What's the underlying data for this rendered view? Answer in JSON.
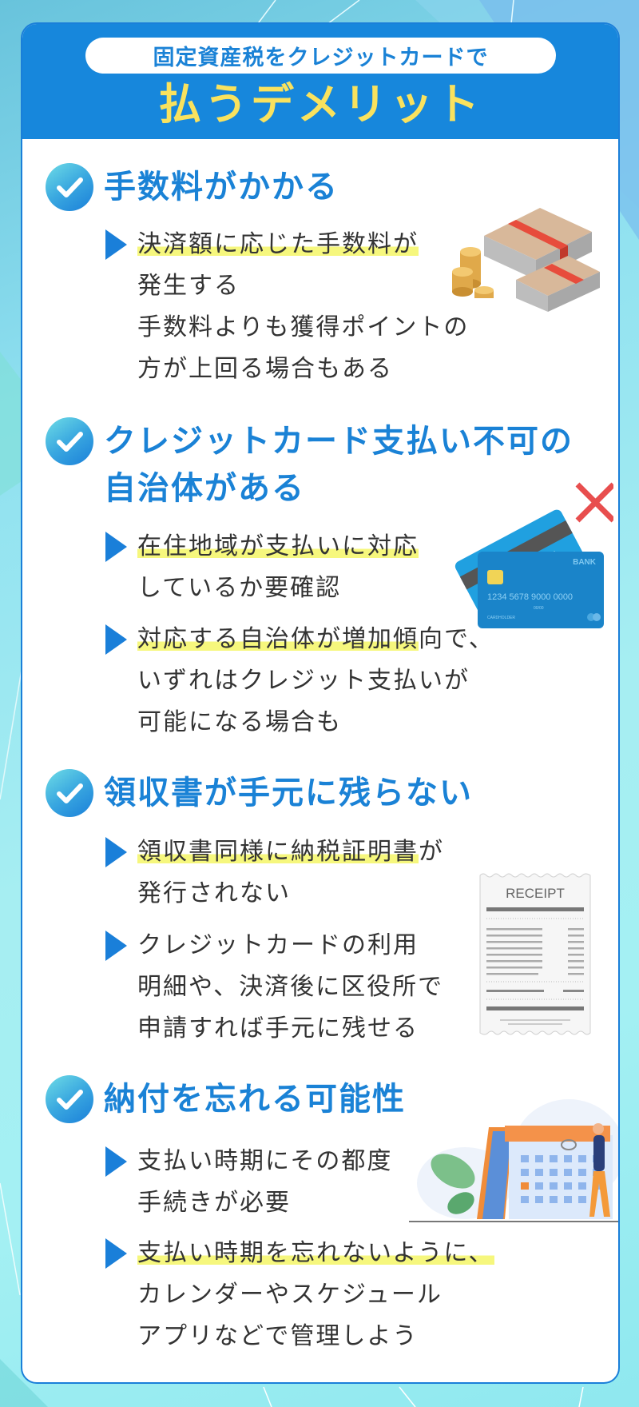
{
  "header": {
    "subtitle": "固定資産税をクレジットカードで",
    "title": "払うデメリット"
  },
  "colors": {
    "accent_blue": "#1a82d6",
    "header_blue": "#1787dc",
    "title_yellow": "#f9e25e",
    "highlight_yellow": "#f6f77d",
    "body_text": "#333333",
    "cross_red": "#e84e4e"
  },
  "sections": [
    {
      "icon": "check-circle-icon",
      "heading_lines": [
        "手数料がかかる"
      ],
      "bullets": [
        {
          "highlight": "決済額に応じた手数料が",
          "rest": "",
          "lines": [
            "発生する",
            "手数料よりも獲得ポイントの",
            "方が上回る場合もある"
          ]
        }
      ],
      "illustration": "money-stacks-and-coins-illustration"
    },
    {
      "icon": "check-circle-icon",
      "heading_lines": [
        "クレジットカード支払い不可の",
        "自治体がある"
      ],
      "bullets": [
        {
          "highlight": "在住地域が支払いに対応",
          "rest": "",
          "lines": [
            "しているか要確認"
          ]
        },
        {
          "highlight": "対応する自治体が増加傾",
          "rest": "向で、",
          "lines": [
            "いずれはクレジット支払いが",
            "可能になる場合も"
          ]
        }
      ],
      "illustration": "credit-cards-with-cross-illustration",
      "card_text": {
        "bank": "BANK",
        "number": "1234 5678 9000 0000",
        "expiry": "00/00",
        "holder": "CARDHOLDER"
      }
    },
    {
      "icon": "check-circle-icon",
      "heading_lines": [
        "領収書が手元に残らない"
      ],
      "bullets": [
        {
          "highlight": "領収書同様に納税証明書",
          "rest": "が",
          "lines": [
            "発行されない"
          ]
        },
        {
          "highlight": "",
          "rest": "クレジットカードの利用",
          "lines": [
            "明細や、決済後に区役所で",
            "申請すれば手元に残せる"
          ]
        }
      ],
      "illustration": "receipt-illustration",
      "receipt_label": "RECEIPT"
    },
    {
      "icon": "check-circle-icon",
      "heading_lines": [
        "納付を忘れる可能性"
      ],
      "bullets": [
        {
          "highlight": "",
          "rest": "支払い時期にその都度",
          "lines": [
            "手続きが必要"
          ]
        },
        {
          "highlight": "支払い時期を忘れないように、",
          "rest": "",
          "lines": [
            "カレンダーやスケジュール",
            "アプリなどで管理しよう"
          ]
        }
      ],
      "illustration": "calendar-with-person-illustration"
    }
  ]
}
